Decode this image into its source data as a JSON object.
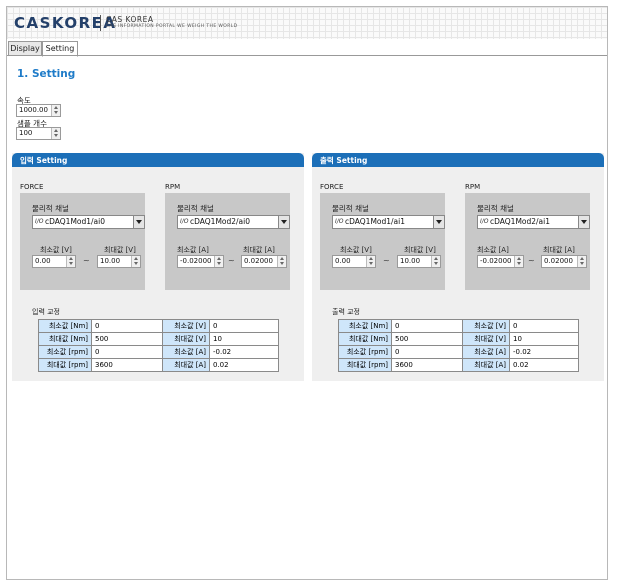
{
  "header": {
    "logo": "CASKOREA",
    "brand_name": "CAS KOREA",
    "brand_sub": "CAS INFORMATION PORTAL WE WEIGH THE WORLD"
  },
  "tabs": [
    {
      "label": "Display",
      "active": false
    },
    {
      "label": "Setting",
      "active": true
    }
  ],
  "page_title": "1. Setting",
  "speed": {
    "label": "속도",
    "value": "1000.00"
  },
  "samples": {
    "label": "샘플 개수",
    "value": "100"
  },
  "input_panel": {
    "title": "입력 Setting",
    "force": {
      "label": "FORCE",
      "channel_label": "물리적 채널",
      "channel": "cDAQ1Mod1/ai0",
      "min_label": "최소값 [V]",
      "min": "0.00",
      "max_label": "최대값 [V]",
      "max": "10.00"
    },
    "rpm": {
      "label": "RPM",
      "channel_label": "물리적 채널",
      "channel": "cDAQ1Mod2/ai0",
      "min_label": "최소값 [A]",
      "min": "-0.02000",
      "max_label": "최대값 [A]",
      "max": "0.02000"
    },
    "calibration": {
      "label": "입력 교정",
      "rows": [
        [
          "최소값 [Nm]",
          "0",
          "최소값 [V]",
          "0"
        ],
        [
          "최대값 [Nm]",
          "500",
          "최대값 [V]",
          "10"
        ],
        [
          "최소값 [rpm]",
          "0",
          "최소값 [A]",
          "-0.02"
        ],
        [
          "최대값 [rpm]",
          "3600",
          "최대값 [A]",
          "0.02"
        ]
      ]
    }
  },
  "output_panel": {
    "title": "출력 Setting",
    "force": {
      "label": "FORCE",
      "channel_label": "물리적 채널",
      "channel": "cDAQ1Mod1/ai1",
      "min_label": "최소값 [V]",
      "min": "0.00",
      "max_label": "최대값 [V]",
      "max": "10.00"
    },
    "rpm": {
      "label": "RPM",
      "channel_label": "물리적 채널",
      "channel": "cDAQ1Mod2/ai1",
      "min_label": "최소값 [A]",
      "min": "-0.02000",
      "max_label": "최대값 [A]",
      "max": "0.02000"
    },
    "calibration": {
      "label": "출력 교정",
      "rows": [
        [
          "최소값 [Nm]",
          "0",
          "최소값 [V]",
          "0"
        ],
        [
          "최대값 [Nm]",
          "500",
          "최대값 [V]",
          "10"
        ],
        [
          "최소값 [rpm]",
          "0",
          "최소값 [A]",
          "-0.02"
        ],
        [
          "최대값 [rpm]",
          "3600",
          "최대값 [A]",
          "0.02"
        ]
      ]
    }
  },
  "colors": {
    "accent": "#1e7bc8",
    "panel_header": "#1c6fb8",
    "calibration_key_bg": "#cfe6fa"
  }
}
